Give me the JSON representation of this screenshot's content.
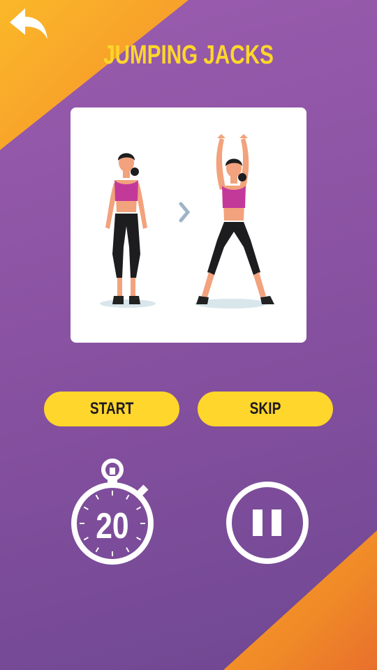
{
  "screen": {
    "title": "JUMPING JACKS"
  },
  "exercise": {
    "illustration": "jumping-jacks-illustration",
    "next_arrow_icon": "chevron-right-icon"
  },
  "buttons": {
    "start_label": "START",
    "skip_label": "SKIP"
  },
  "timer": {
    "value": "20",
    "icon": "stopwatch-icon"
  },
  "controls": {
    "back_icon": "back-arrow-icon",
    "pause_icon": "pause-icon"
  },
  "colors": {
    "background_purple": "#8a52a2",
    "accent_orange": "#f7a12a",
    "button_yellow": "#ffd62b",
    "title_yellow": "#ffd62b",
    "card_white": "#ffffff"
  }
}
